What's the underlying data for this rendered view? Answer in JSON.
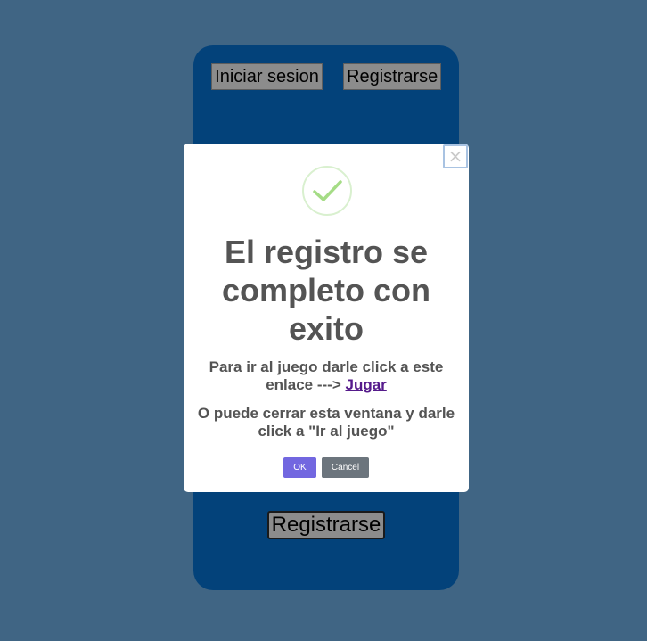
{
  "background": {
    "page_color": "#406584",
    "panel_color": "#03427a"
  },
  "header": {
    "login_label": "Iniciar sesion",
    "register_label": "Registrarse"
  },
  "form": {
    "submit_label": "Registrarse"
  },
  "modal": {
    "close_symbol": "×",
    "icon": "checkmark-success-icon",
    "title": "El registro se completo con exito",
    "text_line1_prefix": "Para ir al juego darle click a este enlace --->",
    "link_label": "Jugar",
    "text_line2": "O puede cerrar esta ventana y darle click a \"Ir al juego\"",
    "ok_label": "OK",
    "cancel_label": "Cancel",
    "ok_color": "#7267e0",
    "cancel_color": "#6c757d"
  }
}
